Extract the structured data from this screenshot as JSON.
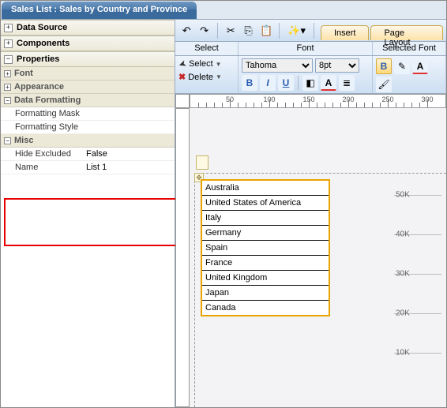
{
  "title": "Sales List : Sales by Country and Province",
  "left": {
    "sections": {
      "data_source": "Data Source",
      "components": "Components",
      "properties": "Properties"
    },
    "props": {
      "font": "Font",
      "appearance": "Appearance",
      "data_formatting": "Data Formatting",
      "formatting_mask": "Formatting Mask",
      "formatting_style": "Formatting Style",
      "misc": "Misc",
      "hide_excluded": {
        "label": "Hide Excluded",
        "value": "False"
      },
      "name": {
        "label": "Name",
        "value": "List 1"
      }
    }
  },
  "ribbon": {
    "tabs": {
      "insert": "Insert",
      "page_layout": "Page Layout"
    },
    "groups": {
      "select": "Select",
      "font": "Font",
      "selected_font": "Selected Font"
    },
    "select_btn": "Select",
    "delete_btn": "Delete",
    "font_name": "Tahoma",
    "font_size": "8pt",
    "buttons": {
      "bold": "B",
      "italic": "I",
      "underline": "U",
      "bold2": "B"
    }
  },
  "ruler": [
    "50",
    "100",
    "150",
    "200",
    "250",
    "300"
  ],
  "list_items": [
    "Australia",
    "United States of America",
    "Italy",
    "Germany",
    "Spain",
    "France",
    "United Kingdom",
    "Japan",
    "Canada"
  ],
  "chart_data": {
    "type": "bar",
    "y_ticks": [
      "50K",
      "40K",
      "30K",
      "20K",
      "10K"
    ]
  },
  "icons": {
    "undo": "↶",
    "redo": "↷",
    "cut": "✂",
    "copy": "⎘",
    "paste": "📋",
    "wizard": "✨▾",
    "cursor": "➤",
    "delete_x": "✖",
    "fill": "◧",
    "fontcolor": "A",
    "align": "≣",
    "pen": "✎",
    "brush": "🖌"
  }
}
